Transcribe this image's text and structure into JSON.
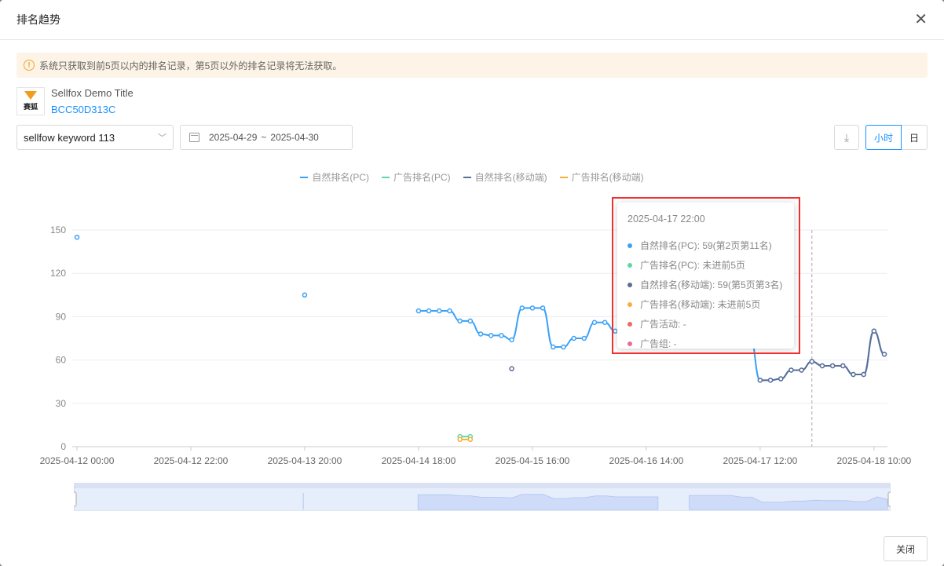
{
  "dialog": {
    "title": "排名趋势",
    "close_icon": "close-icon",
    "footer_close": "关闭"
  },
  "alert": {
    "text": "系统只获取到前5页以内的排名记录，第5页以外的排名记录将无法获取。"
  },
  "product": {
    "logo_text": "赛狐",
    "name": "Sellfox Demo Title",
    "asin": "BCC50D313C"
  },
  "filters": {
    "keyword": "sellfow keyword 113",
    "date_start": "2025-04-29",
    "date_sep": "~",
    "date_end": "2025-04-30",
    "granularity": [
      "小时",
      "日"
    ],
    "selected": "小时"
  },
  "tooltip": {
    "time": "2025-04-17 22:00",
    "rows": [
      {
        "label": "自然排名(PC): 59(第2页第11名)",
        "color": "#3ba1f7"
      },
      {
        "label": "广告排名(PC): 未进前5页",
        "color": "#5fd8a0"
      },
      {
        "label": "自然排名(移动端): 59(第5页第3名)",
        "color": "#5b6e96"
      },
      {
        "label": "广告排名(移动端): 未进前5页",
        "color": "#f7ae3c"
      },
      {
        "label": "广告活动: -",
        "color": "#ef6a5a"
      },
      {
        "label": "广告组: -",
        "color": "#ea6b9b"
      }
    ]
  },
  "chart_data": {
    "type": "line",
    "x_unit": "hours since 2025-04-12 00:00",
    "xlim": [
      0,
      156.6
    ],
    "ylim": [
      0,
      150
    ],
    "yticks": [
      0,
      30,
      60,
      90,
      120,
      150
    ],
    "xticks": [
      {
        "h": 0,
        "label": "2025-04-12 00:00"
      },
      {
        "h": 22,
        "label": "2025-04-12 22:00"
      },
      {
        "h": 44,
        "label": "2025-04-13 20:00"
      },
      {
        "h": 66,
        "label": "2025-04-14 18:00"
      },
      {
        "h": 88,
        "label": "2025-04-15 16:00"
      },
      {
        "h": 110,
        "label": "2025-04-16 14:00"
      },
      {
        "h": 132,
        "label": "2025-04-17 12:00"
      },
      {
        "h": 154,
        "label": "2025-04-18 10:00"
      }
    ],
    "cursor_h": 142,
    "series": [
      {
        "name": "自然排名(PC)",
        "color": "#3ba1f7",
        "points": [
          [
            0,
            145
          ],
          null,
          [
            44,
            105
          ],
          null,
          [
            66,
            94
          ],
          [
            68,
            94
          ],
          [
            70,
            94
          ],
          [
            72,
            94
          ],
          [
            74,
            87
          ],
          [
            76,
            87
          ],
          [
            78,
            78
          ],
          [
            80,
            77
          ],
          [
            82,
            77
          ],
          [
            84,
            74
          ],
          [
            86,
            96
          ],
          [
            88,
            96
          ],
          [
            90,
            96
          ],
          [
            92,
            69
          ],
          [
            94,
            69
          ],
          [
            96,
            75
          ],
          [
            98,
            75
          ],
          [
            100,
            86
          ],
          [
            102,
            86
          ],
          [
            104,
            80
          ],
          [
            106,
            80
          ],
          [
            108,
            80
          ],
          [
            110,
            80
          ],
          [
            112,
            80
          ],
          null,
          [
            118,
            89
          ],
          [
            120,
            89
          ],
          [
            122,
            89
          ],
          [
            124,
            89
          ],
          [
            126,
            89
          ],
          [
            128,
            78
          ],
          [
            130,
            78
          ],
          [
            132,
            46
          ],
          [
            134,
            46
          ],
          [
            136,
            47
          ],
          [
            138,
            53
          ],
          [
            140,
            53
          ],
          [
            142,
            59
          ],
          [
            144,
            56
          ],
          [
            146,
            56
          ],
          [
            148,
            56
          ],
          [
            150,
            50
          ],
          [
            152,
            50
          ],
          [
            154,
            80
          ],
          [
            156,
            64
          ]
        ]
      },
      {
        "name": "广告排名(PC)",
        "color": "#5fd8a0",
        "points": [
          [
            74,
            7
          ],
          [
            76,
            7
          ]
        ]
      },
      {
        "name": "自然排名(移动端)",
        "color": "#5b6e96",
        "points": [
          [
            84,
            54
          ],
          null,
          [
            132,
            46
          ],
          [
            134,
            46
          ],
          [
            136,
            47
          ],
          [
            138,
            53
          ],
          [
            140,
            53
          ],
          [
            142,
            59
          ],
          [
            144,
            56
          ],
          [
            146,
            56
          ],
          [
            148,
            56
          ],
          [
            150,
            50
          ],
          [
            152,
            50
          ],
          [
            154,
            80
          ],
          [
            156,
            64
          ]
        ]
      },
      {
        "name": "广告排名(移动端)",
        "color": "#f7ae3c",
        "points": [
          [
            74,
            5
          ],
          [
            76,
            5
          ]
        ]
      }
    ]
  }
}
